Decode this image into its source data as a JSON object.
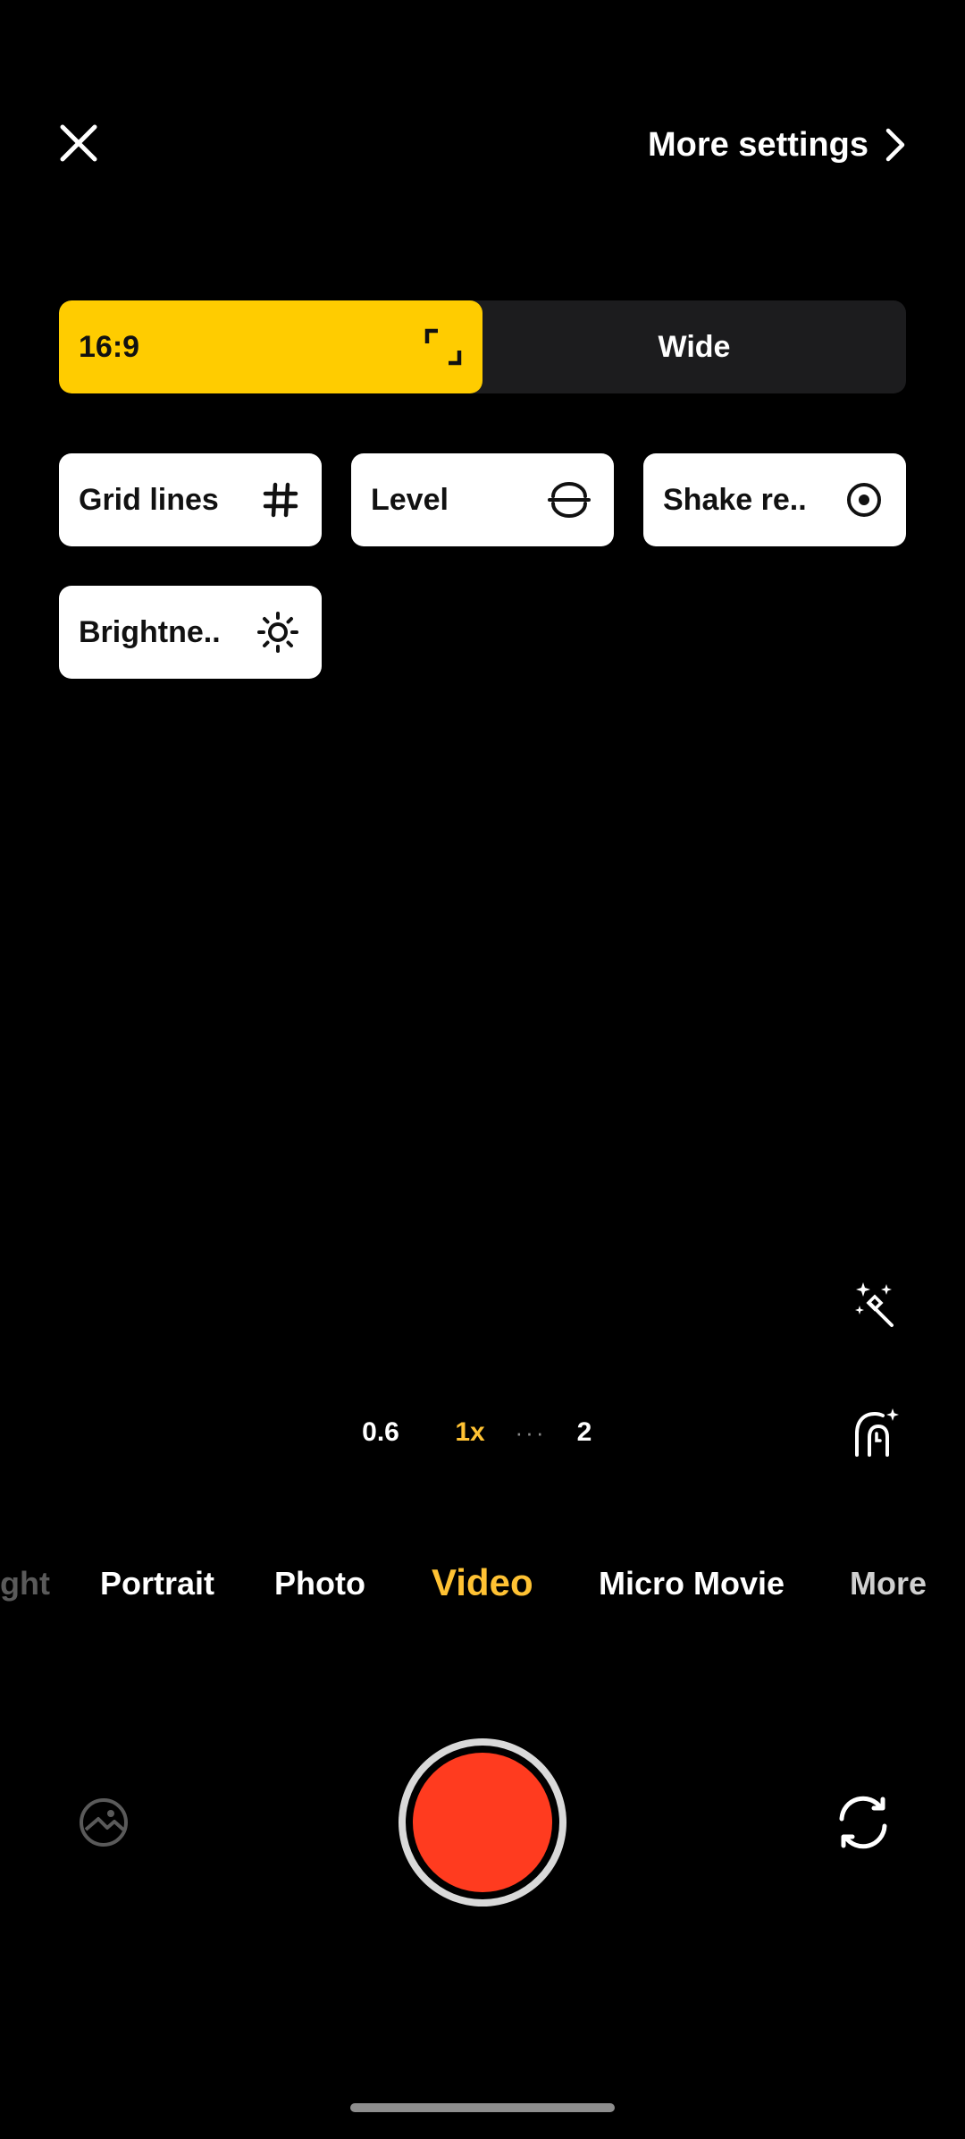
{
  "topbar": {
    "close_icon": "close-icon",
    "more_settings_label": "More settings",
    "chevron_icon": "chevron-right-icon"
  },
  "aspect": {
    "options": [
      {
        "label": "16:9",
        "selected": true,
        "icon": "expand-corners-icon"
      },
      {
        "label": "Wide",
        "selected": false
      }
    ]
  },
  "tiles": [
    {
      "label": "Grid lines",
      "icon": "grid-hash-icon"
    },
    {
      "label": "Level",
      "icon": "level-icon"
    },
    {
      "label": "Shake re..",
      "icon": "shake-reduction-icon"
    },
    {
      "label": "Brightne..",
      "icon": "brightness-icon"
    }
  ],
  "side_icons": [
    "magic-wand-icon",
    "beauty-face-icon"
  ],
  "zoom": {
    "levels": [
      "0.6",
      "1x",
      "2"
    ],
    "selected": "1x",
    "dots": "···"
  },
  "modes": {
    "items": [
      "ght",
      "Portrait",
      "Photo",
      "Video",
      "Micro Movie",
      "More"
    ],
    "selected": "Video"
  },
  "bottom": {
    "gallery_icon": "gallery-icon",
    "shutter": "record-button",
    "switch_icon": "switch-camera-icon"
  },
  "colors": {
    "accent": "#FFCC00",
    "mode_active": "#FFC233",
    "record": "#FF3B1F",
    "background": "#000000"
  }
}
